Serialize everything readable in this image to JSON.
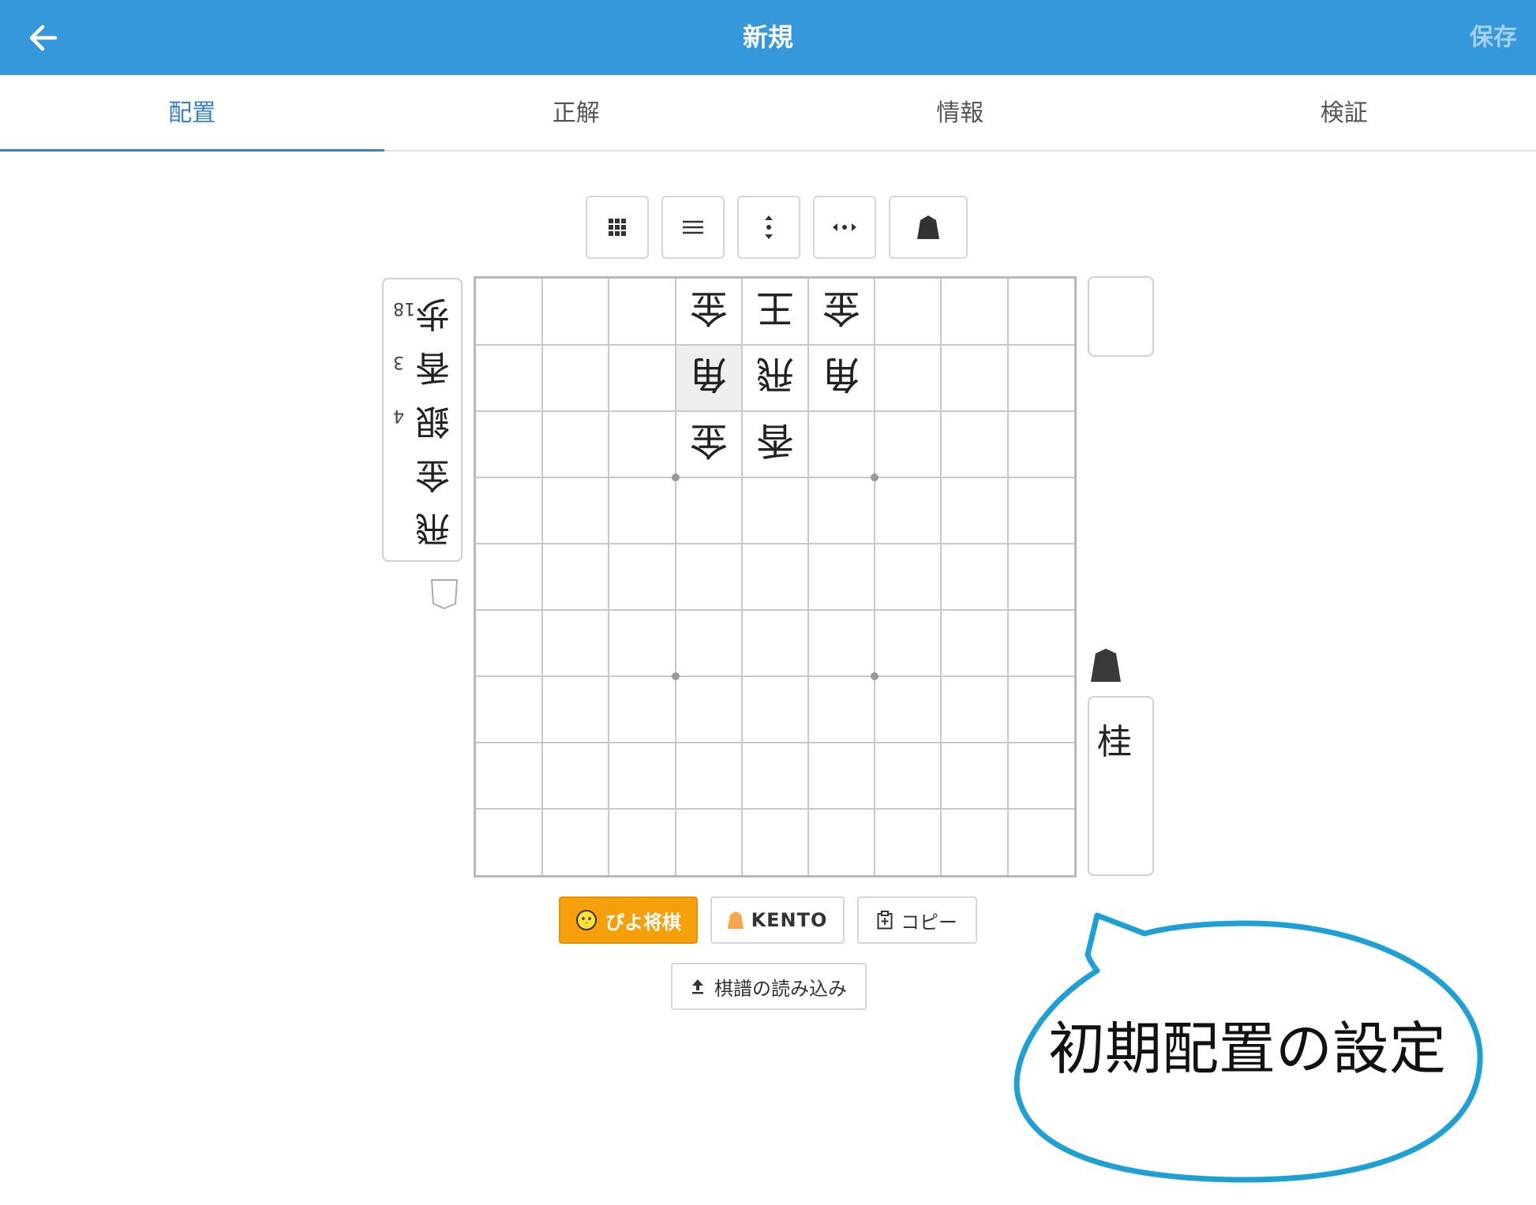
{
  "header": {
    "title": "新規",
    "save_label": "保存"
  },
  "tabs": [
    {
      "label": "配置",
      "active": true
    },
    {
      "label": "正解",
      "active": false
    },
    {
      "label": "情報",
      "active": false
    },
    {
      "label": "検証",
      "active": false
    }
  ],
  "toolbar": {
    "buttons": [
      "grid-icon",
      "hamburger-icon",
      "vertical-dots-icon",
      "horizontal-dots-icon",
      "shogi-piece-icon"
    ]
  },
  "gote_hand": {
    "pieces": [
      {
        "piece": "歩",
        "count": "18"
      },
      {
        "piece": "香",
        "count": "3"
      },
      {
        "piece": "銀",
        "count": "4"
      },
      {
        "piece": "金",
        "count": ""
      },
      {
        "piece": "飛",
        "count": ""
      }
    ]
  },
  "sente_hand": {
    "pieces": [
      {
        "piece": "桂",
        "count": ""
      }
    ]
  },
  "board": {
    "pieces": [
      {
        "row": 1,
        "col": 4,
        "piece": "金",
        "owner": "gote"
      },
      {
        "row": 1,
        "col": 5,
        "piece": "王",
        "owner": "gote"
      },
      {
        "row": 1,
        "col": 6,
        "piece": "金",
        "owner": "gote"
      },
      {
        "row": 2,
        "col": 4,
        "piece": "角",
        "owner": "gote",
        "highlight": true
      },
      {
        "row": 2,
        "col": 5,
        "piece": "飛",
        "owner": "gote"
      },
      {
        "row": 2,
        "col": 6,
        "piece": "角",
        "owner": "gote"
      },
      {
        "row": 3,
        "col": 4,
        "piece": "金",
        "owner": "gote"
      },
      {
        "row": 3,
        "col": 5,
        "piece": "香",
        "owner": "gote"
      }
    ]
  },
  "actions": {
    "piyo_label": "ぴよ将棋",
    "kento_label": "KENTO",
    "copy_label": "コピー",
    "import_label": "棋譜の読み込み"
  },
  "annotation": {
    "text": "初期配置の設定"
  },
  "colors": {
    "header": "#3498db",
    "accent": "#3a7fcc",
    "piyo": "#f5a00a",
    "bubble": "#1ea0d4"
  }
}
